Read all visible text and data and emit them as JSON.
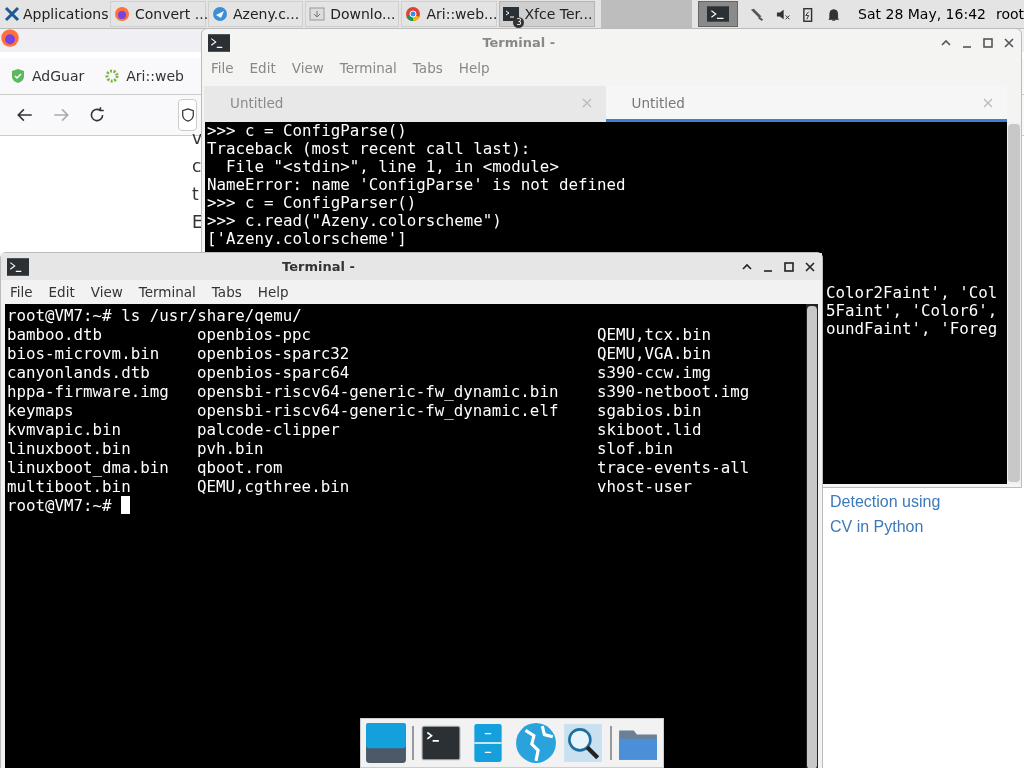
{
  "top_panel": {
    "applications": "Applications",
    "tasks": [
      {
        "label": "Convert ...",
        "selected": false
      },
      {
        "label": "Azeny.c...",
        "selected": false
      },
      {
        "label": "Downlo...",
        "selected": false
      },
      {
        "label": "Ari::web...",
        "selected": false
      },
      {
        "label": "Xfce Ter...",
        "selected": true,
        "badge": "3"
      }
    ],
    "clock": "Sat 28 May, 16:42",
    "user": "root"
  },
  "browser": {
    "bookmarks": [
      "AdGuar",
      "Ari::web"
    ],
    "page_fragments": [
      "v",
      "c",
      "t",
      "E"
    ],
    "links": [
      "Detection using",
      "CV in Python"
    ]
  },
  "back_terminal": {
    "title": "Terminal -",
    "menu": [
      "File",
      "Edit",
      "View",
      "Terminal",
      "Tabs",
      "Help"
    ],
    "tabs": [
      {
        "label": "Untitled",
        "selected": false
      },
      {
        "label": "Untitled",
        "selected": true
      }
    ],
    "lines": [
      ">>> c = ConfigParse()",
      "Traceback (most recent call last):",
      "  File \"<stdin>\", line 1, in <module>",
      "NameError: name 'ConfigParse' is not defined",
      ">>> c = ConfigParser()",
      ">>> c.read(\"Azeny.colorscheme\")",
      "['Azeny.colorscheme']"
    ],
    "right_lines": [
      "Color2Faint', 'Col",
      "5Faint', 'Color6',",
      "oundFaint', 'Foreg"
    ]
  },
  "front_terminal": {
    "title": "Terminal -",
    "menu": [
      "File",
      "Edit",
      "View",
      "Terminal",
      "Tabs",
      "Help"
    ],
    "command": "root@VM7:~# ls /usr/share/qemu/",
    "listing": [
      [
        "bamboo.dtb",
        "openbios-ppc",
        "QEMU,tcx.bin"
      ],
      [
        "bios-microvm.bin",
        "openbios-sparc32",
        "QEMU,VGA.bin"
      ],
      [
        "canyonlands.dtb",
        "openbios-sparc64",
        "s390-ccw.img"
      ],
      [
        "hppa-firmware.img",
        "opensbi-riscv64-generic-fw_dynamic.bin",
        "s390-netboot.img"
      ],
      [
        "keymaps",
        "opensbi-riscv64-generic-fw_dynamic.elf",
        "sgabios.bin"
      ],
      [
        "kvmvapic.bin",
        "palcode-clipper",
        "skiboot.lid"
      ],
      [
        "linuxboot.bin",
        "pvh.bin",
        "slof.bin"
      ],
      [
        "linuxboot_dma.bin",
        "qboot.rom",
        "trace-events-all"
      ],
      [
        "multiboot.bin",
        "QEMU,cgthree.bin",
        "vhost-user"
      ]
    ],
    "prompt": "root@VM7:~#"
  },
  "dock": [
    {
      "kind": "desktop"
    },
    {
      "kind": "terminal"
    },
    {
      "kind": "cabinet"
    },
    {
      "kind": "globe"
    },
    {
      "kind": "search"
    },
    {
      "kind": "folder"
    }
  ]
}
